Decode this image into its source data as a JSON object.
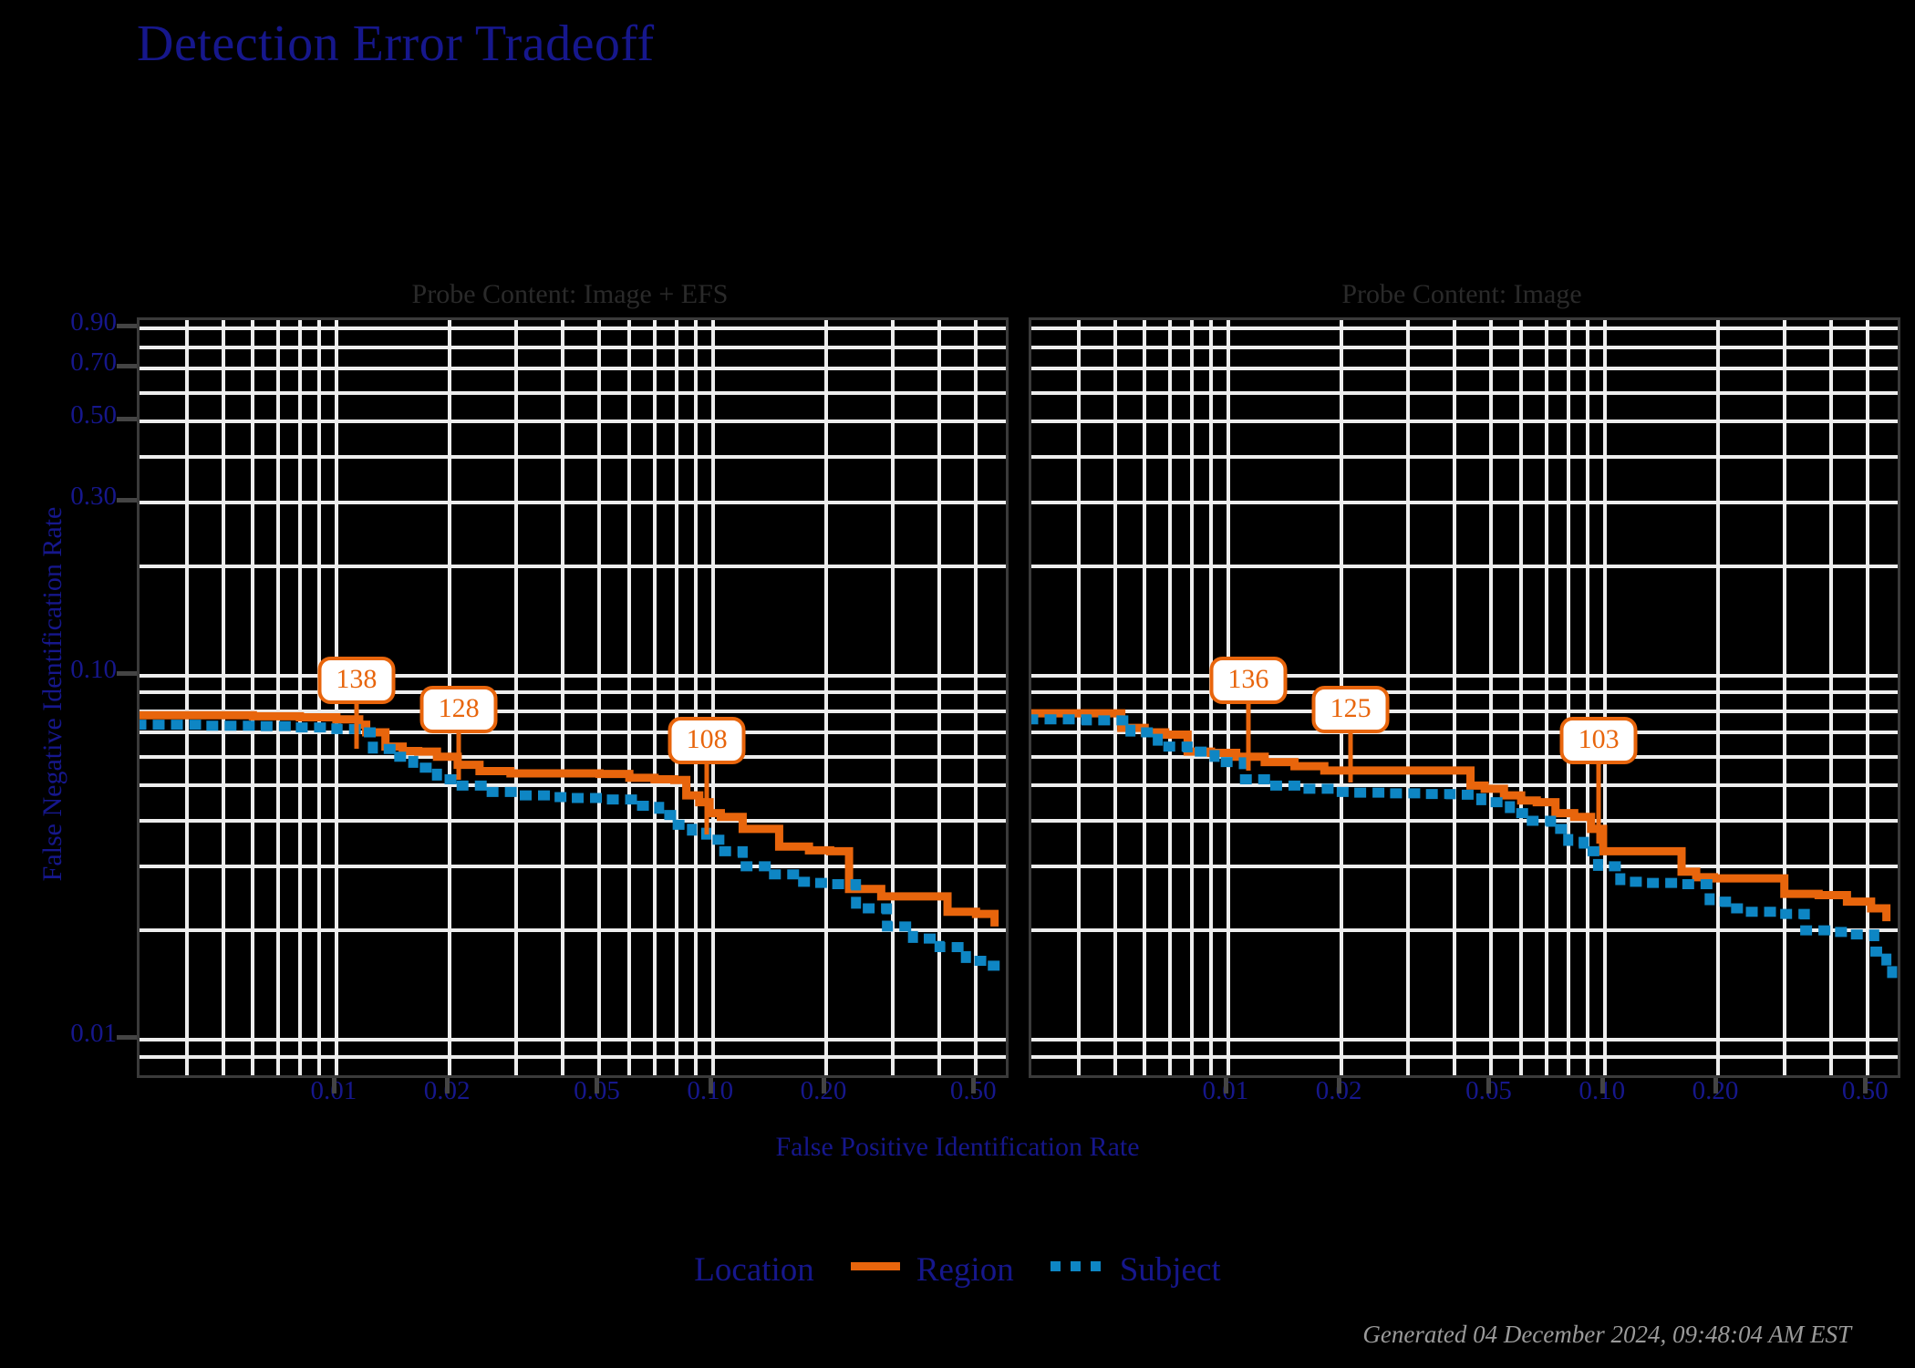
{
  "title": "Detection Error Tradeoff",
  "footer": "Generated 04 December 2024, 09:48:04 AM EST",
  "axes": {
    "x_title": "False Positive Identification Rate",
    "y_title": "False Negative Identification Rate"
  },
  "legend": {
    "title": "Location",
    "entries": [
      {
        "label": "Region",
        "style": "solid",
        "color": "#E8650C"
      },
      {
        "label": "Subject",
        "style": "dotted",
        "color": "#0E86C4"
      }
    ]
  },
  "colors": {
    "background": "#000000",
    "title": "#16178C",
    "axis_text": "#16178C",
    "panel_title": "#2A2A2A",
    "gridline": "#EDEDED",
    "region_line": "#E8650C",
    "subject_line": "#0E86C4",
    "callout_bg": "#FFFFFF",
    "callout_border": "#E8650C",
    "footer": "#9A9A9A"
  },
  "panels": [
    {
      "title": "Probe Content: Image + EFS"
    },
    {
      "title": "Probe Content: Image"
    }
  ],
  "chart_data": {
    "type": "line",
    "title": "Detection Error Tradeoff",
    "xlabel": "False Positive Identification Rate",
    "ylabel": "False Negative Identification Rate",
    "xscale": "probit-log",
    "yscale": "probit-log",
    "xlim": [
      0.003,
      0.6
    ],
    "ylim": [
      0.008,
      0.95
    ],
    "xticks": [
      "0.01",
      "0.02",
      "0.05",
      "0.10",
      "0.20",
      "0.50"
    ],
    "xtick_values": [
      0.01,
      0.02,
      0.05,
      0.1,
      0.2,
      0.5
    ],
    "yticks": [
      "0.90",
      "0.70",
      "0.50",
      "0.30",
      "0.10",
      "0.01"
    ],
    "ytick_values": [
      0.9,
      0.7,
      0.5,
      0.3,
      0.1,
      0.01
    ],
    "grid": true,
    "legend_position": "bottom",
    "panels": [
      {
        "panel_title": "Probe Content: Image + EFS",
        "annotations": [
          {
            "label": "138",
            "x": 0.0115,
            "y": 0.062
          },
          {
            "label": "128",
            "x": 0.0215,
            "y": 0.051
          },
          {
            "label": "108",
            "x": 0.098,
            "y": 0.036
          }
        ],
        "series": [
          {
            "name": "Region",
            "style": "solid",
            "color": "#E8650C",
            "x": [
              0.003,
              0.0045,
              0.006,
              0.008,
              0.01,
              0.0115,
              0.012,
              0.0135,
              0.015,
              0.0165,
              0.0185,
              0.021,
              0.024,
              0.029,
              0.034,
              0.04,
              0.05,
              0.06,
              0.07,
              0.079,
              0.085,
              0.092,
              0.098,
              0.105,
              0.12,
              0.15,
              0.18,
              0.205,
              0.23,
              0.28,
              0.34,
              0.42,
              0.5,
              0.56
            ],
            "y": [
              0.078,
              0.078,
              0.0775,
              0.077,
              0.076,
              0.0735,
              0.07,
              0.064,
              0.0622,
              0.062,
              0.06,
              0.057,
              0.0548,
              0.054,
              0.054,
              0.054,
              0.0538,
              0.0525,
              0.052,
              0.0518,
              0.047,
              0.045,
              0.042,
              0.041,
              0.038,
              0.034,
              0.0332,
              0.033,
              0.026,
              0.0248,
              0.0248,
              0.0225,
              0.0222,
              0.0205
            ]
          },
          {
            "name": "Subject",
            "style": "dotted",
            "color": "#0E86C4",
            "x": [
              0.003,
              0.0045,
              0.006,
              0.008,
              0.01,
              0.0115,
              0.0125,
              0.014,
              0.016,
              0.0185,
              0.0215,
              0.025,
              0.03,
              0.036,
              0.043,
              0.052,
              0.062,
              0.072,
              0.08,
              0.088,
              0.096,
              0.105,
              0.12,
              0.14,
              0.165,
              0.19,
              0.21,
              0.24,
              0.29,
              0.34,
              0.4,
              0.47,
              0.54,
              0.57
            ],
            "y": [
              0.0735,
              0.073,
              0.0728,
              0.0722,
              0.0715,
              0.07,
              0.063,
              0.06,
              0.056,
              0.052,
              0.05,
              0.048,
              0.047,
              0.0465,
              0.0462,
              0.0458,
              0.044,
              0.0415,
              0.039,
              0.0375,
              0.0355,
              0.033,
              0.03,
              0.0285,
              0.0272,
              0.027,
              0.0268,
              0.023,
              0.0205,
              0.019,
              0.018,
              0.0165,
              0.016,
              0.0155
            ]
          }
        ]
      },
      {
        "panel_title": "Probe Content: Image",
        "annotations": [
          {
            "label": "136",
            "x": 0.0115,
            "y": 0.054
          },
          {
            "label": "125",
            "x": 0.0215,
            "y": 0.05
          },
          {
            "label": "103",
            "x": 0.098,
            "y": 0.034
          }
        ],
        "series": [
          {
            "name": "Region",
            "style": "solid",
            "color": "#E8650C",
            "x": [
              0.003,
              0.0042,
              0.0052,
              0.006,
              0.0068,
              0.0078,
              0.009,
              0.0105,
              0.0125,
              0.015,
              0.018,
              0.0215,
              0.026,
              0.032,
              0.039,
              0.044,
              0.048,
              0.054,
              0.06,
              0.066,
              0.074,
              0.083,
              0.092,
              0.099,
              0.13,
              0.16,
              0.175,
              0.195,
              0.24,
              0.3,
              0.37,
              0.44,
              0.51,
              0.56
            ],
            "y": [
              0.079,
              0.079,
              0.072,
              0.07,
              0.069,
              0.062,
              0.0615,
              0.06,
              0.058,
              0.0565,
              0.055,
              0.055,
              0.055,
              0.055,
              0.055,
              0.05,
              0.049,
              0.047,
              0.0455,
              0.045,
              0.042,
              0.041,
              0.038,
              0.033,
              0.033,
              0.029,
              0.028,
              0.0278,
              0.0278,
              0.0252,
              0.025,
              0.024,
              0.023,
              0.0212
            ]
          },
          {
            "name": "Subject",
            "style": "dotted",
            "color": "#0E86C4",
            "x": [
              0.003,
              0.0042,
              0.0055,
              0.0065,
              0.0078,
              0.0092,
              0.011,
              0.013,
              0.0155,
              0.0185,
              0.022,
              0.0265,
              0.032,
              0.039,
              0.047,
              0.056,
              0.064,
              0.072,
              0.08,
              0.088,
              0.096,
              0.11,
              0.13,
              0.16,
              0.19,
              0.21,
              0.24,
              0.29,
              0.34,
              0.4,
              0.46,
              0.52,
              0.56,
              0.58
            ],
            "y": [
              0.076,
              0.0755,
              0.07,
              0.064,
              0.062,
              0.058,
              0.052,
              0.05,
              0.049,
              0.048,
              0.0478,
              0.0476,
              0.0474,
              0.0472,
              0.045,
              0.042,
              0.04,
              0.038,
              0.035,
              0.033,
              0.03,
              0.0272,
              0.027,
              0.0268,
              0.024,
              0.023,
              0.0225,
              0.0222,
              0.02,
              0.0198,
              0.0195,
              0.0175,
              0.016,
              0.014
            ]
          }
        ]
      }
    ]
  }
}
